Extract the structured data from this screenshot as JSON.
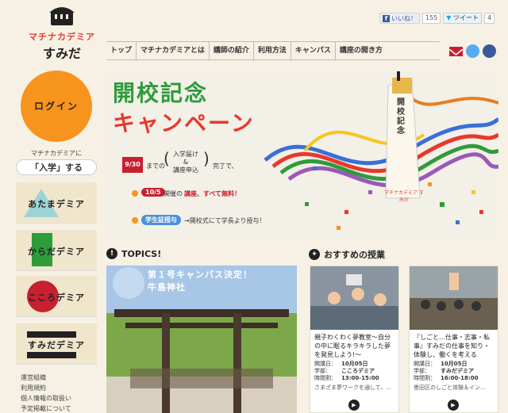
{
  "logo": {
    "brand": "マチナカデミア",
    "sub": "すみだ"
  },
  "social": {
    "like_label": "いいね！",
    "like_count": "155",
    "tweet_label": "ツイート",
    "tweet_count": "4"
  },
  "nav": [
    "トップ",
    "マチナカデミアとは",
    "講師の紹介",
    "利用方法",
    "キャンパス",
    "講座の開き方"
  ],
  "sidebar": {
    "login": "ログイン",
    "enroll_line1": "マチナカデミアに",
    "enroll_line2": "「入学」する",
    "cards": [
      "あたまデミア",
      "からだデミア",
      "こころデミア",
      "すみだデミア"
    ],
    "footer_links": [
      "運営組織",
      "利用規約",
      "個人情報の取扱い",
      "予定掲載について"
    ]
  },
  "hero": {
    "title1": "開校記念",
    "title2": "キャンペーン",
    "date1": "9/30",
    "text1a": "までの",
    "text1b": "入学届け",
    "text1c": "&",
    "text1d": "講座申込",
    "text1e": "完了で、",
    "date2": "10/5",
    "text2a": "開催の",
    "text2b": "講座、すべて無料！",
    "pill3": "学生証授与",
    "text3": "→開校式にて学長より授与！",
    "ribbon": "開校記念",
    "ribbon_brand": "マチナカデミア すみだ"
  },
  "topics": {
    "heading": "TOPICS!",
    "banner1": "第１号キャンパス決定！",
    "banner2": "牛島神社"
  },
  "recommend": {
    "heading": "おすすめの授業",
    "courses": [
      {
        "title": "親子わくわく夢教室〜自分の中に眠るキラキラした夢を発見しよう!〜",
        "date_label": "開講日：",
        "date": "10月05日",
        "dept_label": "学部：",
        "dept": "こころデミア",
        "time_label": "時間割：",
        "time": "13:00-15:00",
        "desc": "さまざま夢ワークを通して、..."
      },
      {
        "title": "『しごと…仕事・志事・私事』すみだの仕事を知り・体験し、働くを考える",
        "date_label": "開講日：",
        "date": "10月05日",
        "dept_label": "学部：",
        "dept": "すみだデミア",
        "time_label": "時間割：",
        "time": "16:00-18:00",
        "desc": "墨田区のしごと体験＆イン..."
      }
    ]
  },
  "colors": {
    "accent": "#f7941d",
    "red": "#c8202f",
    "green": "#2f9b3b",
    "blue": "#1f4e9a"
  }
}
